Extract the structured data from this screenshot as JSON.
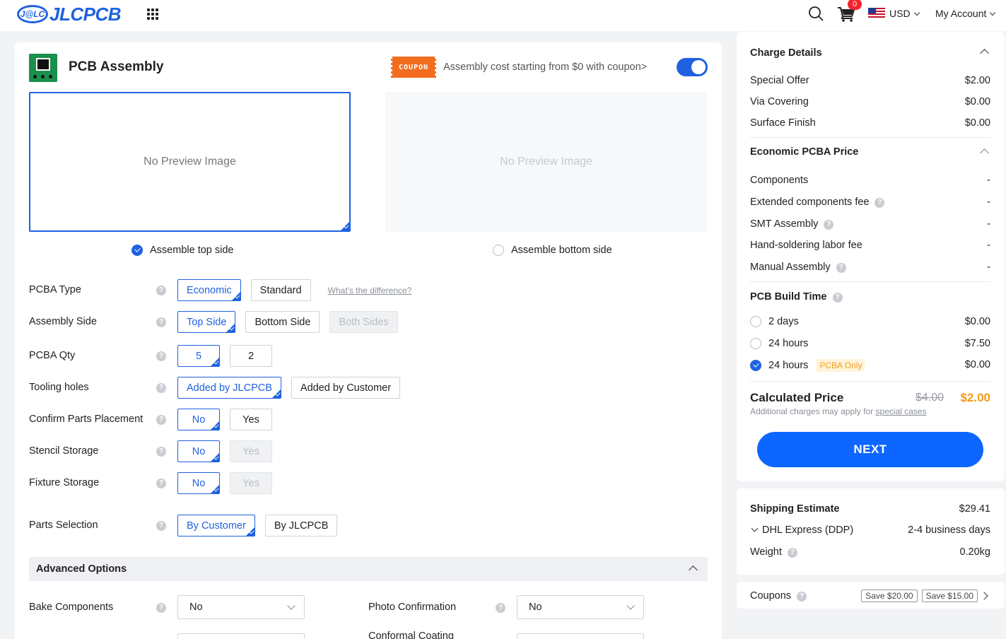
{
  "header": {
    "logo_badge": "J@LC",
    "logo_text": "JLCPCB",
    "cart_count": "0",
    "currency": "USD",
    "account": "My Account"
  },
  "main": {
    "title": "PCB Assembly",
    "coupon_tag": "COUPON",
    "coupon_text": "Assembly cost starting from $0 with coupon>",
    "coupon_toggle_on": true,
    "preview_top": "No Preview Image",
    "preview_bottom": "No Preview Image",
    "assemble_top": "Assemble top side",
    "assemble_bottom": "Assemble bottom side",
    "options": [
      {
        "label": "PCBA Type",
        "buttons": [
          "Economic",
          "Standard"
        ],
        "link": "What's the difference?"
      },
      {
        "label": "Assembly Side",
        "buttons": [
          "Top Side",
          "Bottom Side",
          "Both Sides"
        ]
      },
      {
        "label": "PCBA Qty",
        "buttons": [
          "5",
          "2"
        ]
      },
      {
        "label": "Tooling holes",
        "buttons": [
          "Added by JLCPCB",
          "Added by Customer"
        ]
      },
      {
        "label": "Confirm Parts Placement",
        "buttons": [
          "No",
          "Yes"
        ]
      },
      {
        "label": "Stencil Storage",
        "buttons": [
          "No",
          "Yes"
        ]
      },
      {
        "label": "Fixture Storage",
        "buttons": [
          "No",
          "Yes"
        ]
      },
      {
        "label": "Parts Selection",
        "buttons": [
          "By Customer",
          "By JLCPCB"
        ]
      }
    ],
    "help_glyph": "?",
    "advanced_title": "Advanced Options",
    "bake_label": "Bake Components",
    "bake_value": "No",
    "photo_label": "Photo Confirmation",
    "photo_value": "No",
    "conformal_label": "Conformal Coating"
  },
  "charge": {
    "title": "Charge Details",
    "rows": [
      {
        "label": "Special Offer",
        "value": "$2.00"
      },
      {
        "label": "Via Covering",
        "value": "$0.00"
      },
      {
        "label": "Surface Finish",
        "value": "$0.00"
      }
    ],
    "econ_title": "Economic PCBA Price",
    "econ_rows": [
      {
        "label": "Components",
        "value": "-"
      },
      {
        "label": "Extended components fee",
        "value": "-"
      },
      {
        "label": "SMT Assembly",
        "value": "-"
      },
      {
        "label": "Hand-soldering labor fee",
        "value": "-"
      },
      {
        "label": "Manual Assembly",
        "value": "-"
      }
    ],
    "build_title": "PCB Build Time",
    "build_rows": [
      {
        "label": "2 days",
        "value": "$0.00"
      },
      {
        "label": "24 hours",
        "value": "$7.50"
      },
      {
        "label": "24 hours",
        "value": "$0.00",
        "tag": "PCBA Only"
      }
    ],
    "calc_title": "Calculated Price",
    "old_price": "$4.00",
    "new_price": "$2.00",
    "calc_note": "Additional charges may apply for",
    "calc_link": "special cases",
    "next_label": "NEXT"
  },
  "shipping": {
    "title": "Shipping Estimate",
    "price": "$29.41",
    "method": "DHL Express (DDP)",
    "days": "2-4 business days",
    "weight_label": "Weight",
    "weight_value": "0.20kg"
  },
  "coupons": {
    "label": "Coupons",
    "tags": [
      "Save $20.00",
      "Save $15.00"
    ]
  },
  "colors": {
    "accent": "#1f62e0",
    "next_button": "#0d66ff",
    "price_highlight": "#f39a12",
    "coupon_orange": "#f36d1e"
  }
}
